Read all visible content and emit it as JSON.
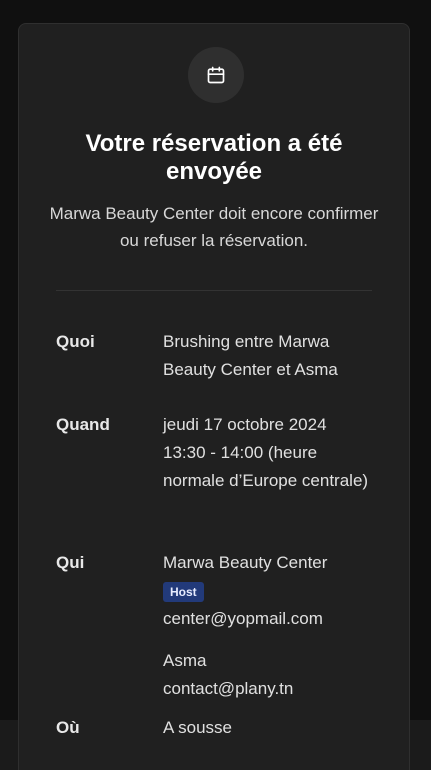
{
  "confirmation": {
    "icon": "calendar-icon",
    "title": "Votre réservation a été envoyée",
    "subtitle": "Marwa Beauty Center doit encore confirmer ou refuser la réservation."
  },
  "details": {
    "what": {
      "label": "Quoi",
      "value": "Brushing entre Marwa Beauty Center et Asma"
    },
    "when": {
      "label": "Quand",
      "date": "jeudi 17 octobre 2024",
      "time": "13:30 - 14:00 (heure normale d’Europe centrale)"
    },
    "who": {
      "label": "Qui",
      "host": {
        "name": "Marwa Beauty Center",
        "badge": "Host",
        "email": "center@yopmail.com"
      },
      "attendee": {
        "name": "Asma",
        "email": "contact@plany.tn"
      }
    },
    "where": {
      "label": "Où",
      "value": "A sousse"
    }
  },
  "colors": {
    "background": "#101010",
    "card": "#202020",
    "badge": "#223a7a"
  }
}
